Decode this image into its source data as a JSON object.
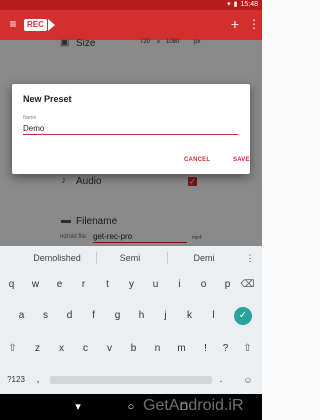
{
  "status_bar": {
    "time": "15:48",
    "wifi_icon": "wifi-icon",
    "battery_icon": "battery-icon"
  },
  "app_bar": {
    "logo_text": "REC",
    "menu_icon": "hamburger-menu-icon",
    "add_icon": "plus-icon",
    "more_icon": "more-vert-icon"
  },
  "settings": {
    "size": {
      "label": "Size",
      "width": "720",
      "height": "1080",
      "suffix": "px"
    },
    "audio": {
      "label": "Audio",
      "checked": true
    },
    "filename": {
      "label": "Filename",
      "note": "ndroid file:",
      "value": "get-rec-pro",
      "ext": "mp4"
    }
  },
  "dialog": {
    "title": "New Preset",
    "field_label": "Name",
    "field_value": "Demo",
    "cancel_label": "CANCEL",
    "save_label": "SAVE"
  },
  "keyboard": {
    "suggestions": [
      "Demolished",
      "Semi",
      "Demi"
    ],
    "row1": [
      "q",
      "w",
      "e",
      "r",
      "t",
      "y",
      "u",
      "i",
      "o",
      "p"
    ],
    "row2": [
      "a",
      "s",
      "d",
      "f",
      "g",
      "h",
      "j",
      "k",
      "l"
    ],
    "row3": [
      "z",
      "x",
      "c",
      "v",
      "b",
      "n",
      "m",
      "!",
      "?"
    ],
    "symbols_label": "?123",
    "comma": ",",
    "period": ".",
    "colors": {
      "accent": "#26a69a"
    }
  },
  "watermark": "GetAndroid.iR",
  "colors": {
    "primary": "#d32f2f",
    "primary_dark": "#b71c1c"
  }
}
